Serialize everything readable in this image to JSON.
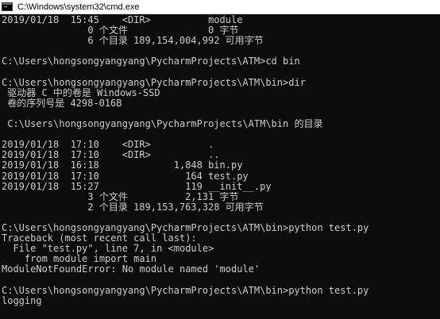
{
  "window": {
    "title": "C:\\Windows\\system32\\cmd.exe"
  },
  "console": {
    "lines": [
      "2019/01/18  15:45    <DIR>          module",
      "               0 个文件              0 字节",
      "               6 个目录 189,154,004,992 可用字节",
      "",
      "C:\\Users\\hongsongyangyang\\PycharmProjects\\ATM>cd bin",
      "",
      "C:\\Users\\hongsongyangyang\\PycharmProjects\\ATM\\bin>dir",
      " 驱动器 C 中的卷是 Windows-SSD",
      " 卷的序列号是 4298-016B",
      "",
      " C:\\Users\\hongsongyangyang\\PycharmProjects\\ATM\\bin 的目录",
      "",
      "2019/01/18  17:10    <DIR>          .",
      "2019/01/18  17:10    <DIR>          ..",
      "2019/01/18  16:18             1,848 bin.py",
      "2019/01/18  17:10               164 test.py",
      "2019/01/18  15:27               119 __init__.py",
      "               3 个文件          2,131 字节",
      "               2 个目录 189,153,763,328 可用字节",
      "",
      "C:\\Users\\hongsongyangyang\\PycharmProjects\\ATM\\bin>python test.py",
      "Traceback (most recent call last):",
      "  File \"test.py\", line 7, in <module>",
      "    from module import main",
      "ModuleNotFoundError: No module named 'module'",
      "",
      "C:\\Users\\hongsongyangyang\\PycharmProjects\\ATM\\bin>python test.py",
      "logging"
    ]
  }
}
